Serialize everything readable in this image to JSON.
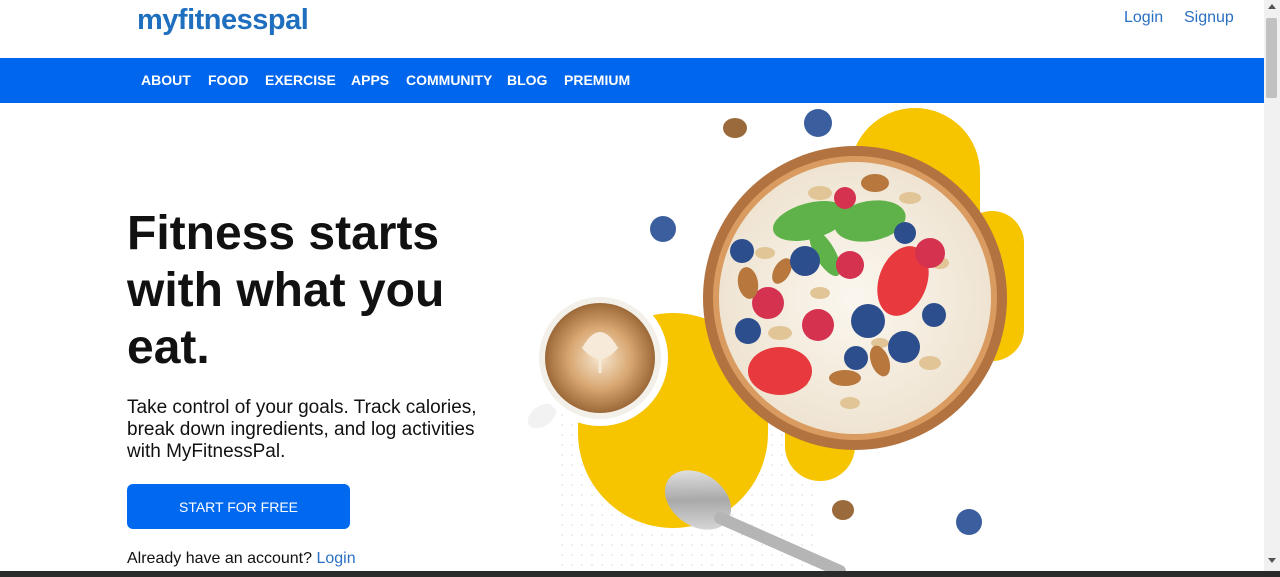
{
  "header": {
    "logo_text": "myfitnesspal",
    "logo_tm": "™",
    "login_label": "Login",
    "signup_label": "Signup",
    "brand_color": "#1f6fbf"
  },
  "nav": {
    "bar_color": "#0066ee",
    "items": [
      {
        "label": "ABOUT"
      },
      {
        "label": "FOOD"
      },
      {
        "label": "EXERCISE"
      },
      {
        "label": "APPS"
      },
      {
        "label": "COMMUNITY"
      },
      {
        "label": "BLOG"
      },
      {
        "label": "PREMIUM"
      }
    ]
  },
  "hero": {
    "title_line1": "Fitness starts",
    "title_line2": "with what you",
    "title_line3": "eat.",
    "subtitle": "Take control of your goals. Track calories, break down ingredients, and log activities with MyFitnessPal.",
    "cta_label": "START FOR FREE",
    "account_prompt": "Already have an account?",
    "account_login": "Login",
    "image_icon": "food-bowl-illustration"
  },
  "colors": {
    "accent_yellow": "#f7c400",
    "cta_blue": "#0069f0"
  }
}
